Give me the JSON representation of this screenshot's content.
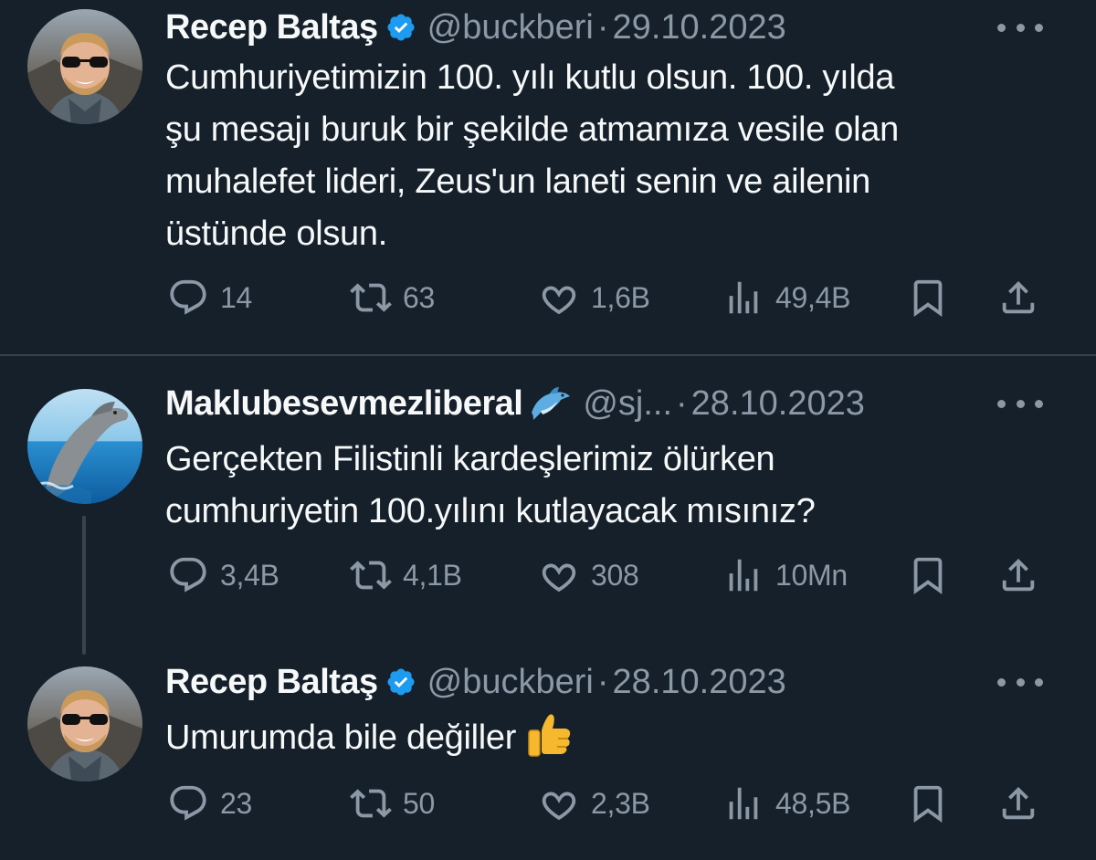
{
  "tweets": [
    {
      "name": "Recep Baltaş",
      "verified": true,
      "handle": "@buckberi",
      "separator": "·",
      "date": "29.10.2023",
      "avatar_icon": "profile-photo-man-sunglasses",
      "lines": [
        "Cumhuriyetimizin 100. yılı kutlu olsun. 100. yılda",
        "şu mesajı buruk bir şekilde atmamıza vesile olan",
        "muhalefet lideri, Zeus'un laneti senin ve ailenin",
        "üstünde olsun."
      ],
      "stats": {
        "replies": "14",
        "retweets": "63",
        "likes": "1,6B",
        "views": "49,4B"
      }
    },
    {
      "name": "Maklubesevmezliberal",
      "verified": false,
      "name_emoji": "dolphin",
      "handle": "@sj...",
      "separator": "·",
      "date": "28.10.2023",
      "avatar_icon": "profile-photo-dolphin",
      "lines": [
        "Gerçekten Filistinli kardeşlerimiz ölürken",
        "cumhuriyetin 100.yılını kutlayacak mısınız?"
      ],
      "stats": {
        "replies": "3,4B",
        "retweets": "4,1B",
        "likes": "308",
        "views": "10Mn"
      }
    },
    {
      "name": "Recep Baltaş",
      "verified": true,
      "handle": "@buckberi",
      "separator": "·",
      "date": "28.10.2023",
      "avatar_icon": "profile-photo-man-sunglasses",
      "lines": [
        "Umurumda bile değiller"
      ],
      "text_emoji": "thumbs-up",
      "stats": {
        "replies": "23",
        "retweets": "50",
        "likes": "2,3B",
        "views": "48,5B"
      }
    }
  ],
  "colors": {
    "background": "#15202b",
    "text": "#f7f9f9",
    "secondary": "#8b98a5",
    "divider": "#38444d",
    "verified": "#1d9bf0"
  }
}
